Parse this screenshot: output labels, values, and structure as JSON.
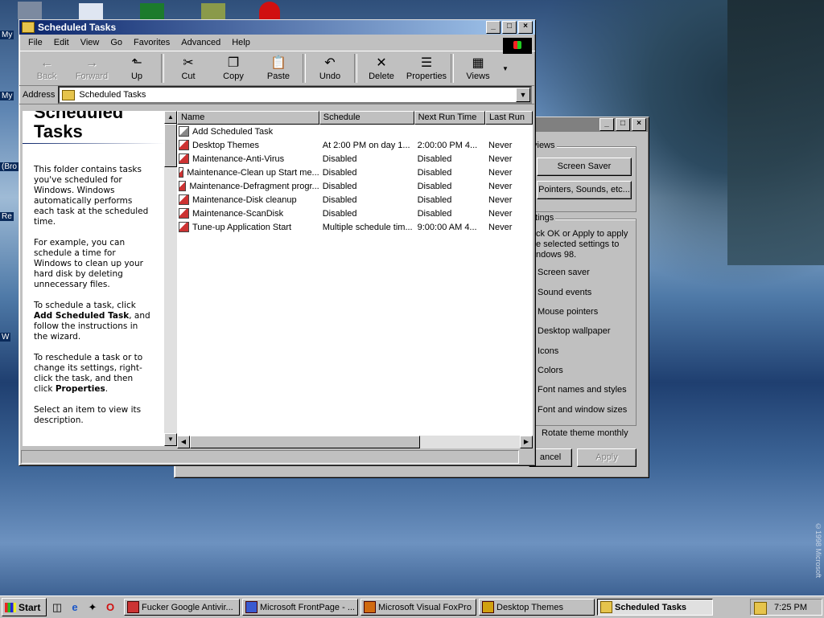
{
  "desktop": {
    "labels": [
      "My",
      "My",
      "(Bro",
      "Re",
      "W"
    ],
    "copyright": "©1998 Microsoft"
  },
  "main_window": {
    "title": "Scheduled Tasks",
    "menu": [
      "File",
      "Edit",
      "View",
      "Go",
      "Favorites",
      "Advanced",
      "Help"
    ],
    "toolbar": [
      {
        "label": "Back",
        "icon": "←",
        "enabled": false
      },
      {
        "label": "Forward",
        "icon": "→",
        "enabled": false
      },
      {
        "label": "Up",
        "icon": "⬑",
        "enabled": true
      },
      {
        "label": "Cut",
        "icon": "✂",
        "enabled": true
      },
      {
        "label": "Copy",
        "icon": "❐",
        "enabled": true
      },
      {
        "label": "Paste",
        "icon": "📋",
        "enabled": true
      },
      {
        "label": "Undo",
        "icon": "↶",
        "enabled": true
      },
      {
        "label": "Delete",
        "icon": "✕",
        "enabled": true
      },
      {
        "label": "Properties",
        "icon": "☰",
        "enabled": true
      },
      {
        "label": "Views",
        "icon": "▦",
        "enabled": true
      }
    ],
    "address_label": "Address",
    "address_value": "Scheduled Tasks",
    "left_pane": {
      "title_line1": "Scheduled",
      "title_line2": "Tasks",
      "p1": "This folder contains tasks you've scheduled for Windows. Windows automatically performs each task at the scheduled time.",
      "p2": "For example, you can schedule a time for Windows to clean up your hard disk by deleting unnecessary files.",
      "p3_a": "To schedule a task, click ",
      "p3_b": "Add Scheduled Task",
      "p3_c": ", and follow the instructions in the wizard.",
      "p4_a": "To reschedule a task or to change its settings, right-click the task, and then click ",
      "p4_b": "Properties",
      "p4_c": ".",
      "p5": "Select an item to view its description."
    },
    "columns": [
      "Name",
      "Schedule",
      "Next Run Time",
      "Last Run"
    ],
    "rows": [
      {
        "name": "Add Scheduled Task",
        "schedule": "",
        "next": "",
        "last": ""
      },
      {
        "name": "Desktop Themes",
        "schedule": "At 2:00 PM on day 1...",
        "next": "2:00:00 PM  4...",
        "last": "Never"
      },
      {
        "name": "Maintenance-Anti-Virus",
        "schedule": "Disabled",
        "next": "Disabled",
        "last": "Never"
      },
      {
        "name": "Maintenance-Clean up Start me...",
        "schedule": "Disabled",
        "next": "Disabled",
        "last": "Never"
      },
      {
        "name": "Maintenance-Defragment progr...",
        "schedule": "Disabled",
        "next": "Disabled",
        "last": "Never"
      },
      {
        "name": "Maintenance-Disk cleanup",
        "schedule": "Disabled",
        "next": "Disabled",
        "last": "Never"
      },
      {
        "name": "Maintenance-ScanDisk",
        "schedule": "Disabled",
        "next": "Disabled",
        "last": "Never"
      },
      {
        "name": "Tune-up Application Start",
        "schedule": "Multiple schedule tim...",
        "next": "9:00:00 AM  4...",
        "last": "Never"
      }
    ]
  },
  "back_window": {
    "group1_title": "views",
    "btn_screen_saver": "Screen Saver",
    "btn_pointers": "Pointers, Sounds, etc...",
    "group2_title": "ttings",
    "desc": "ck OK or Apply to apply e selected settings to ndows 98.",
    "items": [
      "Screen saver",
      "Sound events",
      "Mouse pointers",
      "Desktop wallpaper",
      "Icons",
      "Colors",
      "Font names and styles",
      "Font and window sizes"
    ],
    "rotate": "Rotate theme monthly",
    "btn_cancel": "ancel",
    "btn_apply": "Apply"
  },
  "taskbar": {
    "start": "Start",
    "tasks": [
      {
        "label": "Fucker Google Antivir...",
        "active": false
      },
      {
        "label": "Microsoft FrontPage - ...",
        "active": false
      },
      {
        "label": "Microsoft Visual FoxPro",
        "active": false
      },
      {
        "label": "Desktop Themes",
        "active": false
      },
      {
        "label": "Scheduled Tasks",
        "active": true
      }
    ],
    "clock": "7:25 PM"
  }
}
